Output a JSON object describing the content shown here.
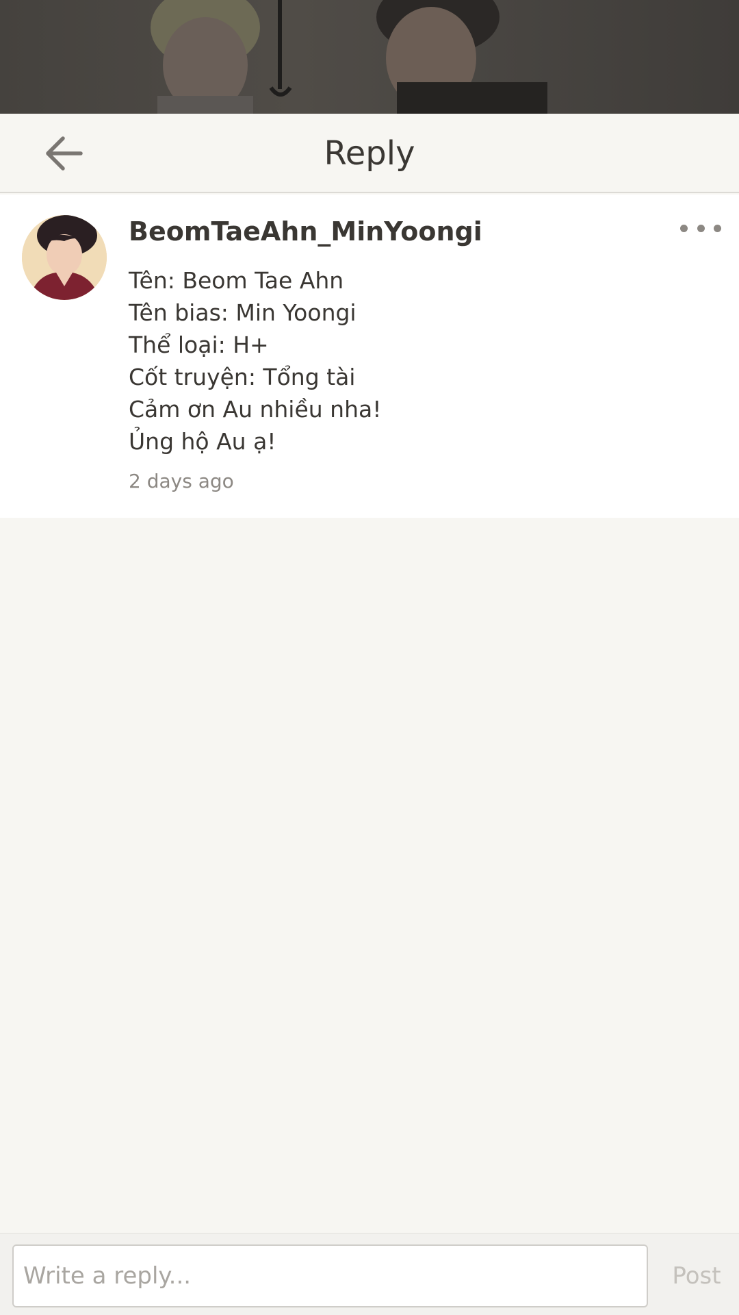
{
  "header": {
    "title": "Reply",
    "back_icon": "arrow-left-icon"
  },
  "comment": {
    "username": "BeomTaeAhn_MinYoongi",
    "lines": [
      "Tên: Beom Tae Ahn",
      "Tên bias: Min Yoongi",
      "Thể loại: H+",
      "Cốt truyện: Tổng tài",
      "Cảm ơn Au nhiều nha!",
      "Ủng hộ Au ạ!"
    ],
    "timestamp": "2 days ago",
    "more_icon": "more-dots-icon"
  },
  "reply_bar": {
    "placeholder": "Write a reply...",
    "post_label": "Post"
  },
  "colors": {
    "background": "#f7f6f2",
    "text": "#3a3733",
    "muted": "#8c8883",
    "post_disabled": "#c4c1bc"
  }
}
